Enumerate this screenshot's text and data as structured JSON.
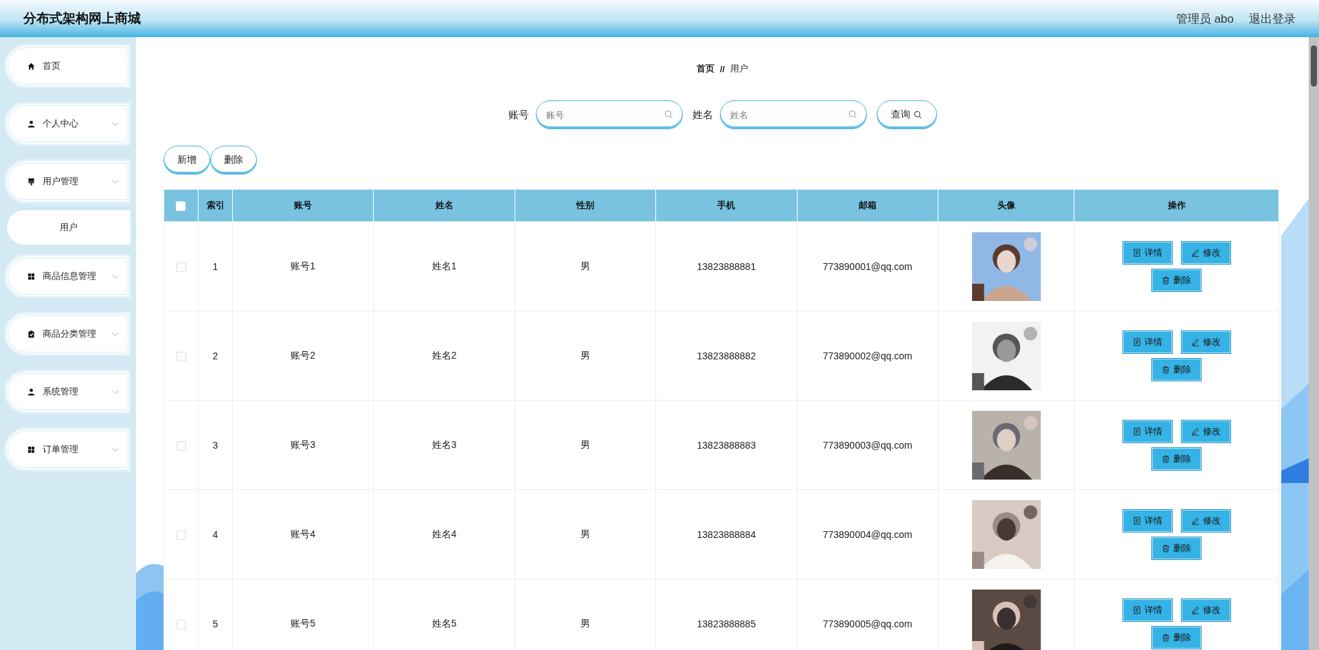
{
  "header": {
    "title": "分布式架构网上商城",
    "user": "管理员 abo",
    "logout": "退出登录"
  },
  "sidebar": {
    "items": [
      {
        "label": "首页",
        "kind": "link"
      },
      {
        "label": "个人中心",
        "kind": "group"
      },
      {
        "label": "用户管理",
        "kind": "group",
        "children": [
          {
            "label": "用户"
          }
        ]
      },
      {
        "label": "商品信息管理",
        "kind": "group"
      },
      {
        "label": "商品分类管理",
        "kind": "group"
      },
      {
        "label": "系统管理",
        "kind": "group"
      },
      {
        "label": "订单管理",
        "kind": "group"
      }
    ]
  },
  "breadcrumb": [
    "首页",
    "//",
    "用户"
  ],
  "search": {
    "fields": [
      {
        "label": "账号",
        "placeholder": "账号"
      },
      {
        "label": "姓名",
        "placeholder": "姓名"
      }
    ],
    "button": "查询"
  },
  "actions": [
    "新增",
    "删除"
  ],
  "table": {
    "select_all": {
      "checked": false
    },
    "columns": [
      "索引",
      "账号",
      "姓名",
      "性别",
      "手机",
      "邮箱",
      "头像",
      "操作"
    ],
    "rows": [
      {
        "checked": false,
        "cells": [
          "1",
          "账号1",
          "姓名1",
          "男",
          "13823888881",
          "773890001@qq.com"
        ],
        "buttons": [
          "详情",
          "修改",
          "删除"
        ]
      },
      {
        "checked": false,
        "cells": [
          "2",
          "账号2",
          "姓名2",
          "男",
          "13823888882",
          "773890002@qq.com"
        ],
        "buttons": [
          "详情",
          "修改",
          "删除"
        ]
      },
      {
        "checked": false,
        "cells": [
          "3",
          "账号3",
          "姓名3",
          "男",
          "13823888883",
          "773890003@qq.com"
        ],
        "buttons": [
          "详情",
          "修改",
          "删除"
        ]
      },
      {
        "checked": false,
        "cells": [
          "4",
          "账号4",
          "姓名4",
          "男",
          "13823888884",
          "773890004@qq.com"
        ],
        "buttons": [
          "详情",
          "修改",
          "删除"
        ]
      },
      {
        "checked": false,
        "cells": [
          "5",
          "账号5",
          "姓名5",
          "男",
          "13823888885",
          "773890005@qq.com"
        ],
        "buttons": [
          "详情",
          "修改",
          "删除"
        ]
      }
    ]
  }
}
